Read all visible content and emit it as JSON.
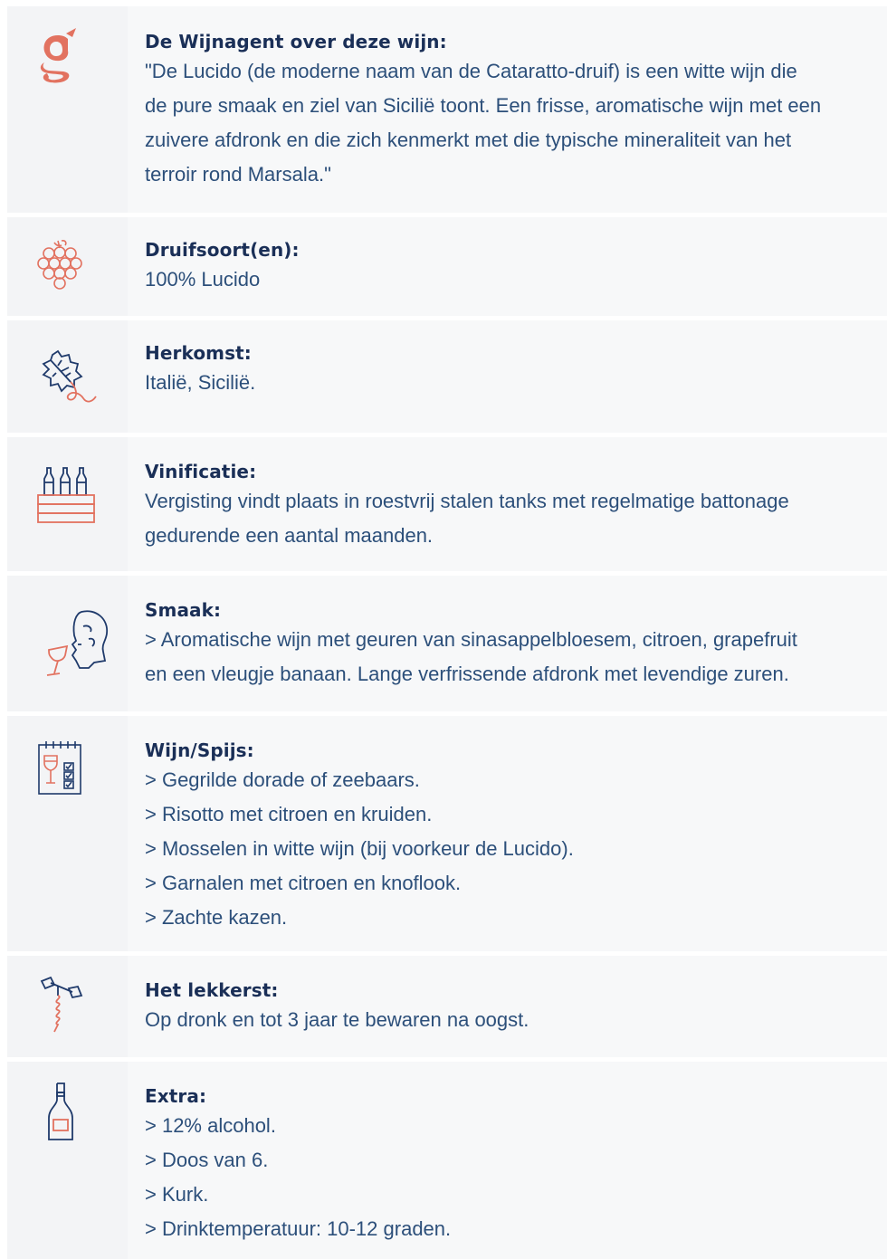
{
  "colors": {
    "heading": "#1a2f57",
    "text": "#2c4f7a",
    "accent": "#e27260",
    "navy_icon": "#1f3a6b",
    "row_bg": "#f7f8f9",
    "icon_col_bg": "#f3f4f6"
  },
  "sections": [
    {
      "icon": "wijnagent-logo-icon",
      "heading": "De Wijnagent over deze wijn:",
      "lines": [
        "\"De Lucido (de moderne naam van de Cataratto-druif) is een witte wijn die",
        "de pure smaak en ziel van Sicilië toont. Een frisse, aromatische wijn met een",
        "zuivere afdronk en die zich kenmerkt met die typische mineraliteit van het",
        "terroir rond Marsala.\""
      ]
    },
    {
      "icon": "grapes-icon",
      "heading": "Druifsoort(en):",
      "lines": [
        "100% Lucido"
      ]
    },
    {
      "icon": "vine-leaf-icon",
      "heading": "Herkomst:",
      "lines": [
        "Italië, Sicilië."
      ]
    },
    {
      "icon": "wine-crate-icon",
      "heading": "Vinificatie:",
      "lines": [
        "Vergisting vindt plaats in roestvrij stalen tanks met regelmatige battonage",
        "gedurende een aantal maanden."
      ]
    },
    {
      "icon": "tasting-face-icon",
      "heading": "Smaak:",
      "lines": [
        "> Aromatische wijn met geuren van sinasappelbloesem, citroen, grapefruit",
        "en een vleugje banaan. Lange verfrissende afdronk met levendige zuren."
      ]
    },
    {
      "icon": "pairing-checklist-icon",
      "heading": "Wijn/Spijs:",
      "lines": [
        "> Gegrilde dorade of zeebaars.",
        "> Risotto met citroen en kruiden.",
        "> Mosselen in witte wijn (bij voorkeur de Lucido).",
        "> Garnalen met citroen en knoflook.",
        "> Zachte kazen."
      ]
    },
    {
      "icon": "corkscrew-icon",
      "heading": "Het lekkerst:",
      "lines": [
        "Op dronk en tot 3 jaar te bewaren na oogst."
      ]
    },
    {
      "icon": "wine-bottle-icon",
      "heading": "Extra:",
      "lines": [
        "> 12% alcohol.",
        "> Doos van 6.",
        "> Kurk.",
        "> Drinktemperatuur: 10-12 graden."
      ]
    }
  ]
}
